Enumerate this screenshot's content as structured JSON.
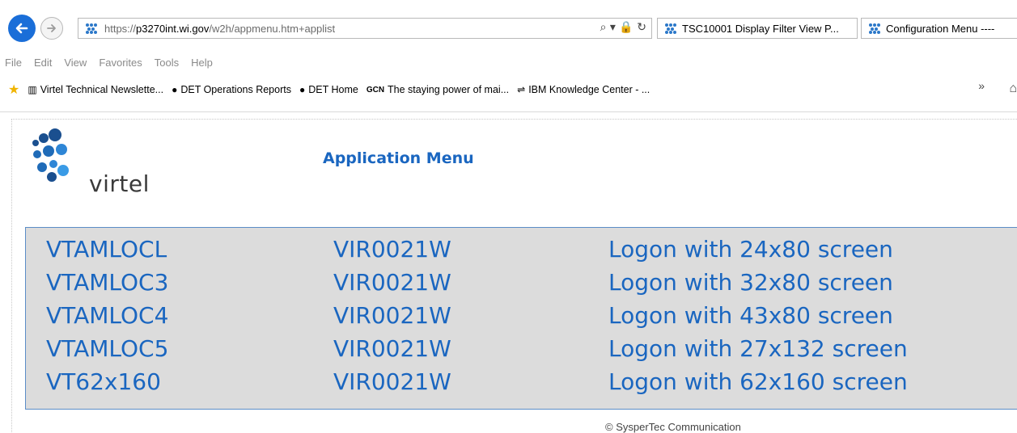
{
  "browser": {
    "address": {
      "scheme": "https://",
      "host": "p3270int.wi.gov",
      "path": "/w2h/appmenu.htm+applist",
      "icons": "⌕ ▾ 🔒 ↻"
    },
    "tabs": [
      {
        "label": "TSC10001 Display Filter View P..."
      },
      {
        "label": "Configuration Menu ----"
      }
    ],
    "menubar": [
      "File",
      "Edit",
      "View",
      "Favorites",
      "Tools",
      "Help"
    ],
    "favorites": [
      {
        "label": "Virtel Technical Newslette...",
        "icon": "▥"
      },
      {
        "label": "DET Operations Reports",
        "icon": "●"
      },
      {
        "label": "DET Home",
        "icon": "●"
      },
      {
        "label": "The staying power of mai...",
        "icon": "GCN"
      },
      {
        "label": "IBM Knowledge Center - ...",
        "icon": "⇌"
      }
    ],
    "more": "»"
  },
  "page": {
    "logo_text": "virtel",
    "title": "Application Menu",
    "applications": [
      {
        "name": "VTAMLOCL",
        "transaction": "VIR0021W",
        "description": "Logon with 24x80 screen"
      },
      {
        "name": "VTAMLOC3",
        "transaction": "VIR0021W",
        "description": "Logon with 32x80 screen"
      },
      {
        "name": "VTAMLOC4",
        "transaction": "VIR0021W",
        "description": "Logon with 43x80 screen"
      },
      {
        "name": "VTAMLOC5",
        "transaction": "VIR0021W",
        "description": "Logon with 27x132 screen"
      },
      {
        "name": "VT62x160",
        "transaction": "VIR0021W",
        "description": "Logon with 62x160 screen"
      }
    ],
    "footer": "© SysperTec Communication"
  },
  "colors": {
    "accent": "#1a66c0",
    "panel_bg": "#dcdcdc",
    "panel_border": "#5b8dc7"
  }
}
